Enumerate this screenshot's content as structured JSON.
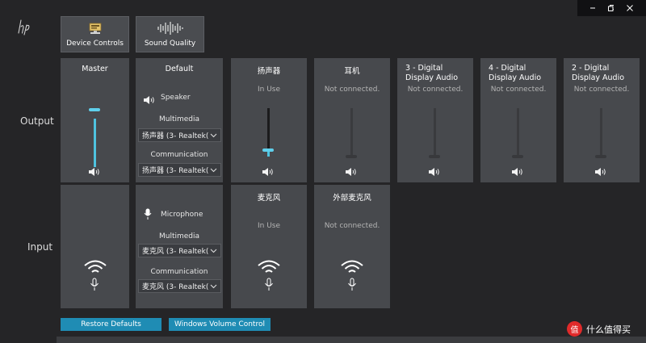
{
  "window": {
    "controls": [
      "minimize",
      "restore",
      "close"
    ]
  },
  "top_buttons": [
    {
      "label": "Device Controls",
      "icon": "device-controls-icon"
    },
    {
      "label": "Sound Quality",
      "icon": "waveform-icon"
    }
  ],
  "rows": {
    "output": "Output",
    "input": "Input"
  },
  "output": {
    "master": {
      "title": "Master",
      "level": 0.98
    },
    "default": {
      "device": "Speaker",
      "multimedia_label": "Multimedia",
      "multimedia_value": "扬声器 (3- Realtek(",
      "communication_label": "Communication",
      "communication_value": "扬声器 (3- Realtek("
    },
    "devices": [
      {
        "name": "扬声器",
        "status": "In Use",
        "level": 0.11
      },
      {
        "name": "耳机",
        "status": "Not connected.",
        "level": 0
      },
      {
        "name": "3 - Digital Display Audio",
        "status": "Not connected.",
        "level": 0
      },
      {
        "name": "4 - Digital Display Audio",
        "status": "Not connected.",
        "level": 0
      },
      {
        "name": "2 - Digital Display Audio",
        "status": "Not connected.",
        "level": 0
      }
    ]
  },
  "input": {
    "default": {
      "device": "Microphone",
      "multimedia_label": "Multimedia",
      "multimedia_value": "麦克风 (3- Realtek(",
      "communication_label": "Communication",
      "communication_value": "麦克风 (3- Realtek("
    },
    "devices": [
      {
        "name": "麦克风",
        "status": "In Use"
      },
      {
        "name": "外部麦克风",
        "status": "Not connected."
      }
    ]
  },
  "bottom_buttons": {
    "restore": "Restore Defaults",
    "windows_volume": "Windows Volume Control"
  },
  "watermark": {
    "text": "什么值得买",
    "logo_char": "值"
  },
  "colors": {
    "accent": "#4fc3df",
    "button": "#1f8cb4",
    "panel": "#47494d",
    "background": "#252527"
  }
}
